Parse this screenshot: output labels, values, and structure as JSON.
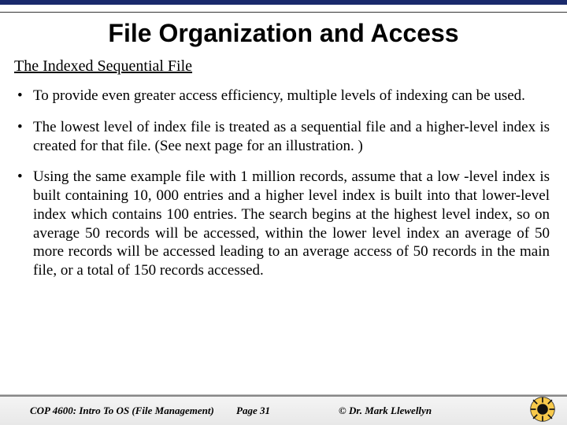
{
  "title": "File Organization and Access",
  "subheading": "The Indexed Sequential File",
  "bullets": [
    "To provide even greater access efficiency, multiple levels of indexing can be used.",
    "The lowest level of index file is treated as a sequential file and a higher-level index is created for that file.  (See next page for an illustration. )",
    "Using the same example file with 1 million records, assume that a low -level index is built containing 10, 000 entries and a higher level index is built into that lower-level index which contains 100 entries.  The search begins at the highest level index, so on average 50 records will be accessed, within the lower level index an average of 50 more records will be accessed leading to an average access of 50 records in the main file, or a total of 150 records accessed."
  ],
  "footer": {
    "course": "COP 4600: Intro To OS  (File Management)",
    "page": "Page 31",
    "author": "© Dr. Mark Llewellyn"
  }
}
